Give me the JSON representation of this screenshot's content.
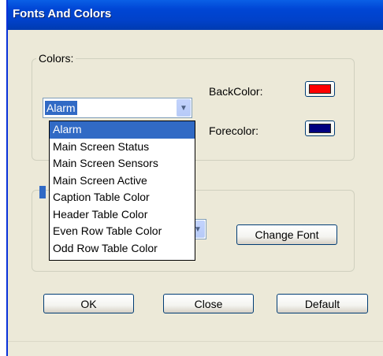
{
  "window": {
    "title": "Fonts And Colors"
  },
  "colors_group": {
    "caption": "Colors:",
    "combo_value": "Alarm",
    "backcolor_label": "BackColor:",
    "forecolor_label": "Forecolor:",
    "backcolor_value": "#ff0000",
    "forecolor_value": "#000080"
  },
  "dropdown": {
    "selected": "Alarm",
    "items": [
      "Alarm",
      "Main Screen Status",
      "Main Screen Sensors",
      "Main Screen Active",
      "Caption Table Color",
      "Header Table Color",
      "Even Row Table Color",
      "Odd Row Table Color"
    ]
  },
  "fonts_group": {
    "change_font_label": "Change Font"
  },
  "buttons": {
    "ok": "OK",
    "close": "Close",
    "default": "Default"
  },
  "icons": {
    "combo_arrow": "chevron-down-icon"
  }
}
